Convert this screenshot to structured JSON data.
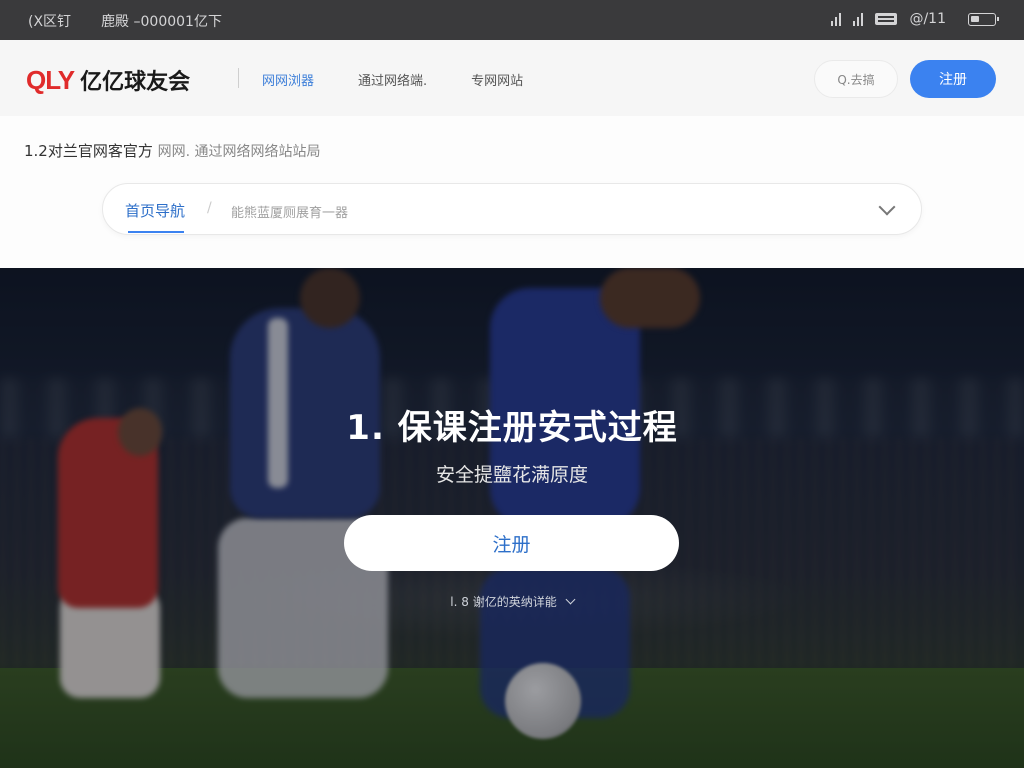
{
  "status_bar": {
    "left_label": "(X区钉",
    "carrier_text": "鹿殿 –000001亿下",
    "time": "@/11"
  },
  "header": {
    "logo_mark": "QLY",
    "logo_name": "亿亿球友会",
    "nav": [
      {
        "label": "网网浏器"
      },
      {
        "label": "通过网络端."
      },
      {
        "label": "专网网站"
      }
    ],
    "search_label": "Q.去搞",
    "register_label": "注册"
  },
  "subarea": {
    "crumb_main": "1.2对兰官网客官方",
    "crumb_muted": "网网. 通过网络网络站站局",
    "nav_home": "首页导航",
    "nav_slash": "/",
    "nav_sub": "能熊蓝厦厕展育一器"
  },
  "hero": {
    "title": "1. 保课注册安式过程",
    "subtitle": "安全提鹽花满原度",
    "button_label": "注册",
    "hint": "l. 8 谢亿的英纳详能"
  },
  "colors": {
    "accent": "#3b82f0",
    "logo_red": "#e02b2b",
    "status_bar_bg": "#3a3a3c"
  }
}
